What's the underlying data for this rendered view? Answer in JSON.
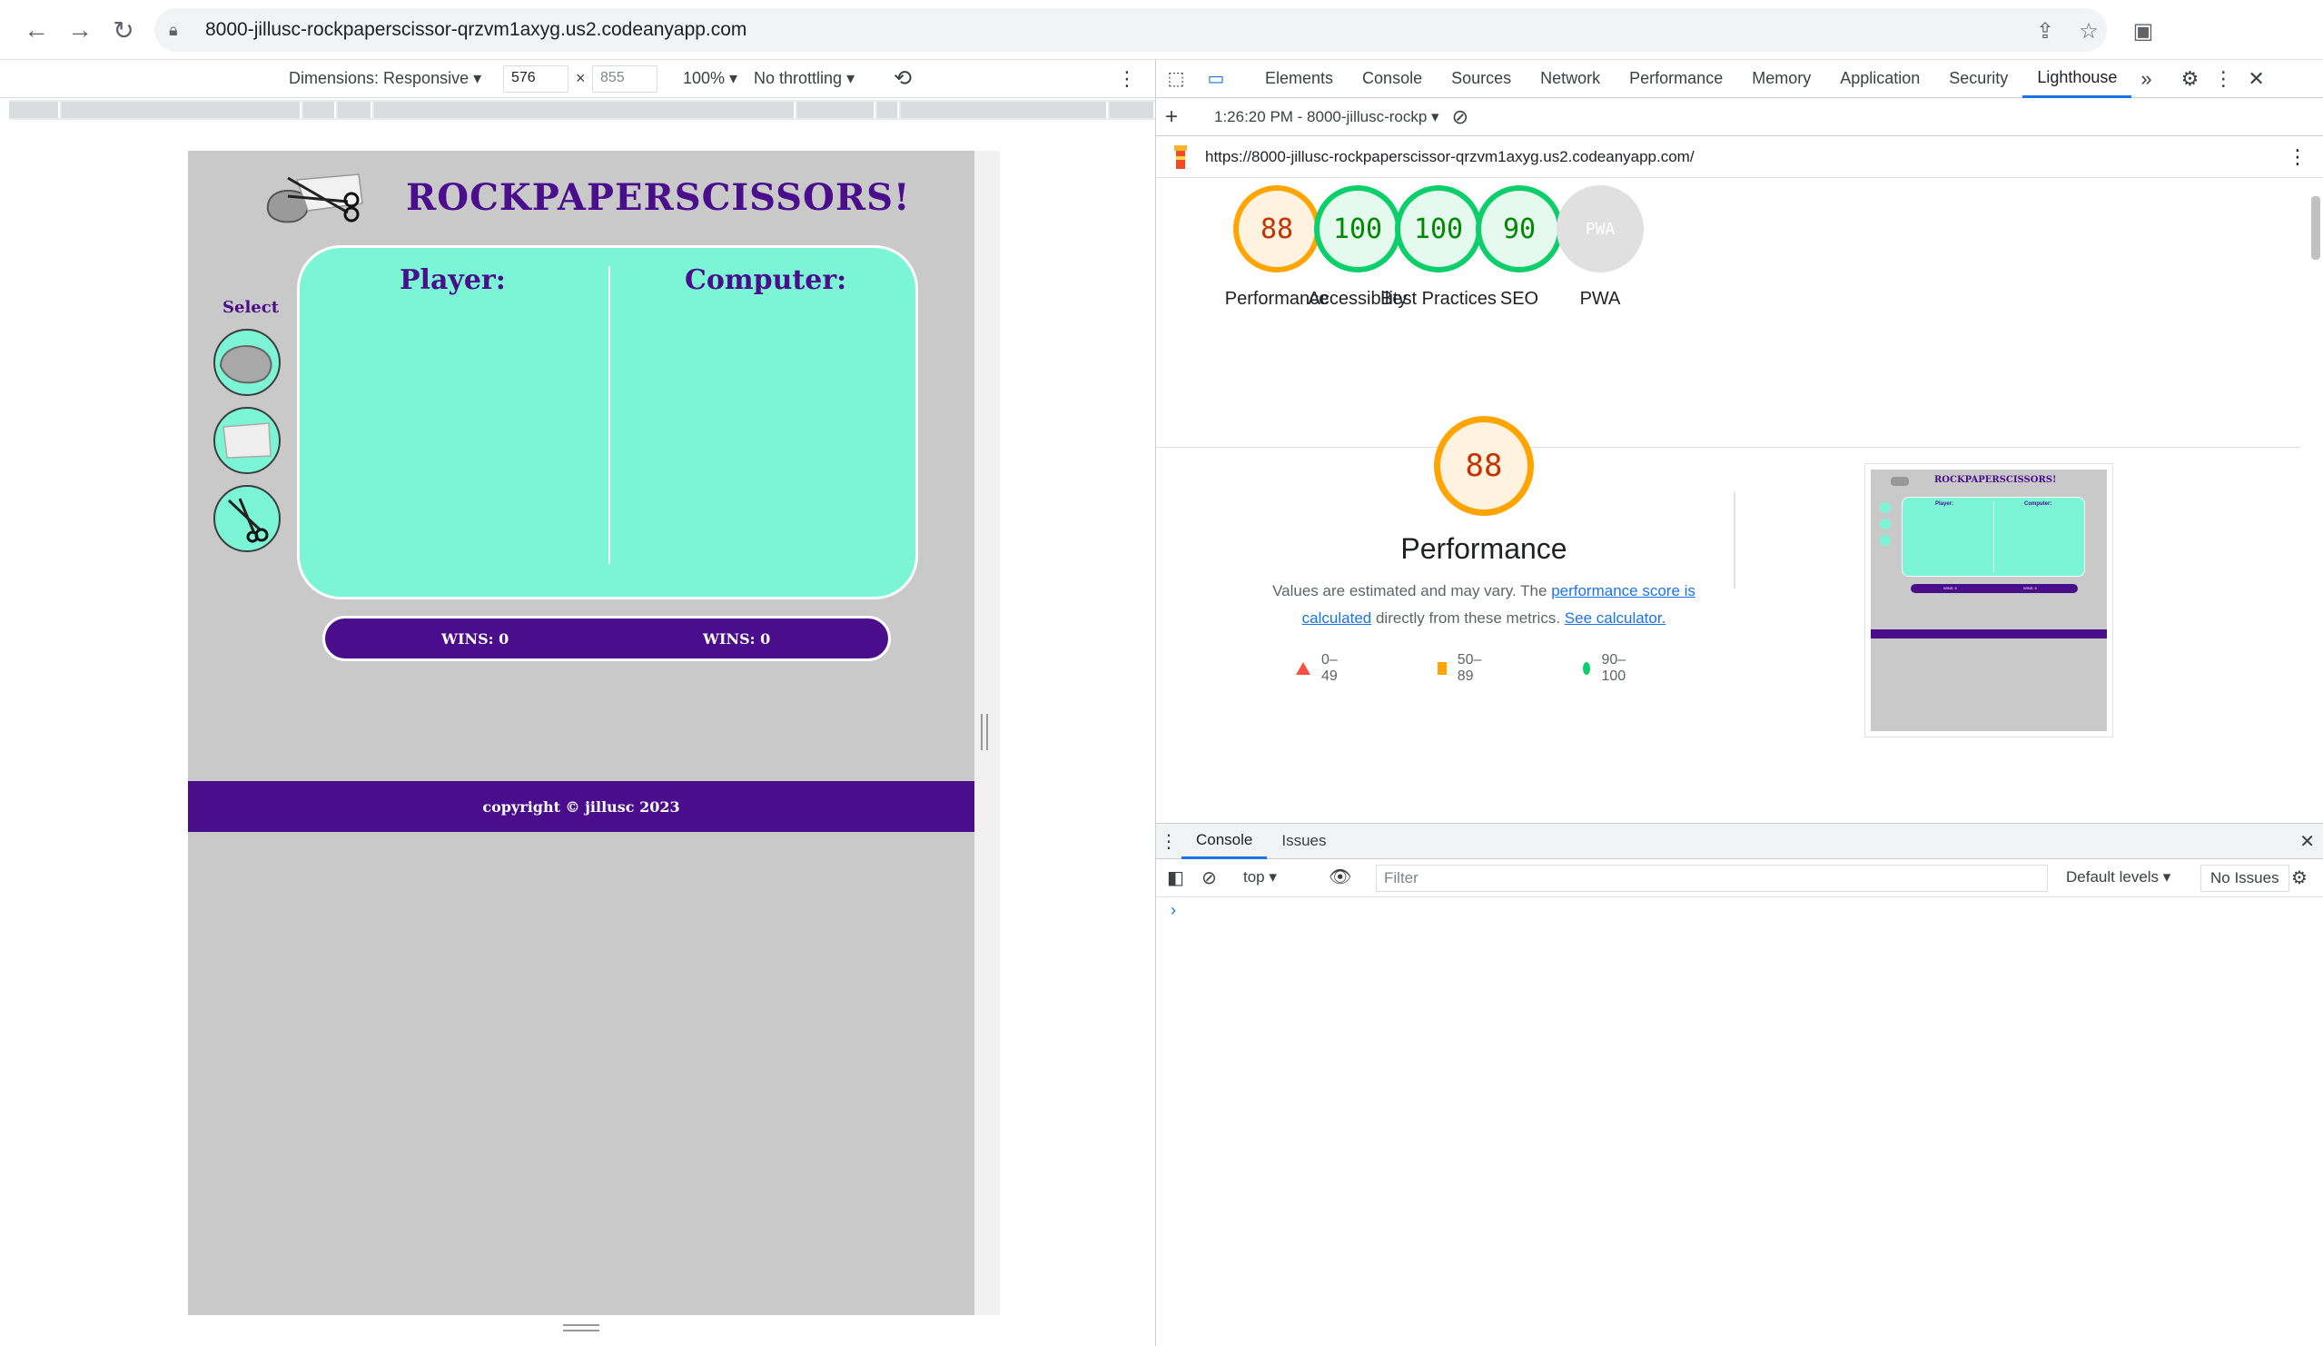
{
  "browser": {
    "url": "8000-jillusc-rockpaperscissor-qrzvm1axyg.us2.codeanyapp.com",
    "icons": [
      "back-icon",
      "forward-icon",
      "reload-icon",
      "lock-icon",
      "share-icon",
      "star-icon",
      "side-panel-icon"
    ]
  },
  "device_toolbar": {
    "dimensions_label": "Dimensions: Responsive",
    "width_value": "576",
    "height_value": "855",
    "times": "×",
    "zoom": "100%",
    "throttling": "No throttling"
  },
  "game": {
    "title": "ROCKPAPERSCISSORS!",
    "select_label": "Select",
    "player_heading": "Player:",
    "computer_heading": "Computer:",
    "player_wins": "WINS: 0",
    "computer_wins": "WINS: 0",
    "footer": "copyright © jillusc 2023",
    "choices": [
      "rock",
      "paper",
      "scissors"
    ],
    "colors": {
      "purple": "#4a0d8c",
      "mint": "#7cf5d6",
      "gray": "#c9c9c9"
    }
  },
  "devtools": {
    "tabs": [
      "Elements",
      "Console",
      "Sources",
      "Network",
      "Performance",
      "Memory",
      "Application",
      "Security",
      "Lighthouse"
    ],
    "active_tab": "Lighthouse",
    "more_tabs": "»",
    "lighthouse_bar": {
      "report_label": "1:26:20 PM - 8000-jillusc-rockp"
    },
    "report_url": "https://8000-jillusc-rockpaperscissor-qrzvm1axyg.us2.codeanyapp.com/",
    "scores": [
      {
        "label": "Performance",
        "value": "88",
        "status": "orange"
      },
      {
        "label": "Accessibility",
        "value": "100",
        "status": "green"
      },
      {
        "label": "Best Practices",
        "value": "100",
        "status": "green"
      },
      {
        "label": "SEO",
        "value": "90",
        "status": "green"
      },
      {
        "label": "PWA",
        "value": "PWA",
        "status": "gray"
      }
    ],
    "performance": {
      "score": "88",
      "title": "Performance",
      "desc_before": "Values are estimated and may vary. The ",
      "desc_link1": "performance score is calculated",
      "desc_middle": " directly from these metrics. ",
      "desc_link2": "See calculator.",
      "legend": [
        {
          "range": "0–49",
          "shape": "triangle",
          "color": "#ff4e42"
        },
        {
          "range": "50–89",
          "shape": "square",
          "color": "#ffa400"
        },
        {
          "range": "90–100",
          "shape": "circle",
          "color": "#0cce6b"
        }
      ]
    },
    "thumbnail": {
      "title": "ROCKPAPERSCISSORS!",
      "player": "Player:",
      "computer": "Computer:",
      "wins": "WINS: 0"
    },
    "console": {
      "tabs": [
        "Console",
        "Issues"
      ],
      "context": "top",
      "filter_placeholder": "Filter",
      "levels": "Default levels",
      "issues": "No Issues",
      "prompt": "›"
    }
  }
}
